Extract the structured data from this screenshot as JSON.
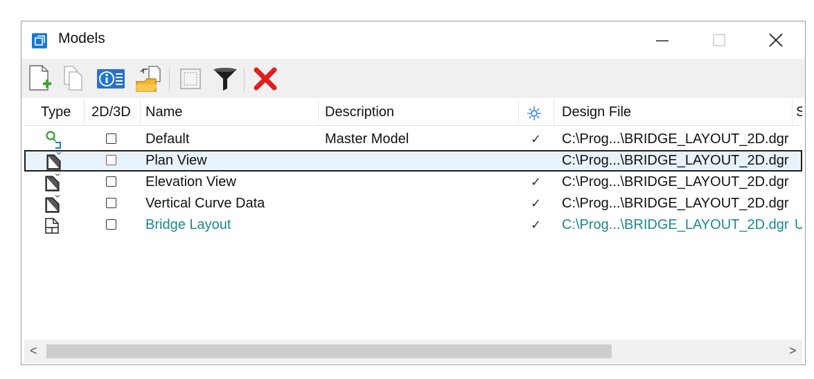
{
  "window": {
    "title": "Models",
    "icons": {
      "app": "models-window-icon",
      "minimize": "minimize-icon",
      "maximize": "maximize-icon",
      "close": "close-icon"
    }
  },
  "toolbar": {
    "buttons": [
      {
        "icon": "new-model-icon"
      },
      {
        "icon": "copy-model-icon"
      },
      {
        "icon": "model-properties-icon",
        "highlighted": true
      },
      {
        "icon": "import-model-icon"
      },
      {
        "icon": "select-icon"
      },
      {
        "icon": "filter-icon"
      },
      {
        "icon": "delete-icon"
      }
    ],
    "highlight_color": "#c0001a"
  },
  "columns": {
    "type": "Type",
    "dim": "2D/3D",
    "name": "Name",
    "description": "Description",
    "design_file": "Design File",
    "extra": "S"
  },
  "rows": [
    {
      "type_icon": "default-model-icon",
      "name": "Default",
      "description": "Master Model",
      "checked": "✓",
      "design_file": "C:\\Prog...\\BRIDGE_LAYOUT_2D.dgr",
      "extra": "",
      "selected": false,
      "color": "#111111"
    },
    {
      "type_icon": "sheet-model-icon",
      "name": "Plan View",
      "description": "",
      "checked": "",
      "design_file": "C:\\Prog...\\BRIDGE_LAYOUT_2D.dgr",
      "extra": "",
      "selected": true,
      "color": "#111111"
    },
    {
      "type_icon": "sheet-model-icon",
      "name": "Elevation View",
      "description": "",
      "checked": "✓",
      "design_file": "C:\\Prog...\\BRIDGE_LAYOUT_2D.dgr",
      "extra": "",
      "selected": false,
      "color": "#111111"
    },
    {
      "type_icon": "sheet-model-icon",
      "name": "Vertical Curve Data",
      "description": "",
      "checked": "✓",
      "design_file": "C:\\Prog...\\BRIDGE_LAYOUT_2D.dgr",
      "extra": "",
      "selected": false,
      "color": "#111111"
    },
    {
      "type_icon": "drawing-model-icon",
      "name": "Bridge Layout",
      "description": "",
      "checked": "✓",
      "design_file": "C:\\Prog...\\BRIDGE_LAYOUT_2D.dgr",
      "extra": "U",
      "selected": false,
      "color": "#1a8a8a"
    }
  ],
  "scrollbar": {
    "left_arrow": "<",
    "right_arrow": ">",
    "position": 0.0
  }
}
